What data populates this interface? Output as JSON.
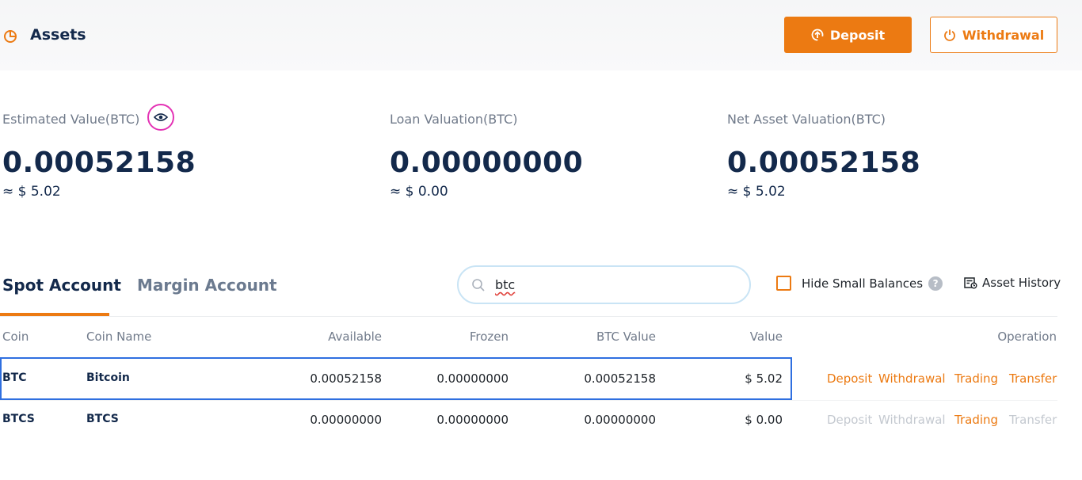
{
  "header": {
    "title": "Assets",
    "deposit_label": "Deposit",
    "withdrawal_label": "Withdrawal"
  },
  "summary": [
    {
      "label": "Estimated Value(BTC)",
      "value": "0.00052158",
      "approx": "≈ $ 5.02"
    },
    {
      "label": "Loan Valuation(BTC)",
      "value": "0.00000000",
      "approx": "≈ $ 0.00"
    },
    {
      "label": "Net Asset Valuation(BTC)",
      "value": "0.00052158",
      "approx": "≈ $ 5.02"
    }
  ],
  "tabs": {
    "spot": "Spot Account",
    "margin": "Margin Account"
  },
  "search": {
    "value": "btc"
  },
  "hide_small_balances": "Hide Small Balances",
  "help_glyph": "?",
  "asset_history": "Asset History",
  "table": {
    "columns": [
      "Coin",
      "Coin Name",
      "Available",
      "Frozen",
      "BTC Value",
      "Value",
      "Operation"
    ],
    "rows": [
      {
        "coin": "BTC",
        "name": "Bitcoin",
        "available": "0.00052158",
        "frozen": "0.00000000",
        "btc_value": "0.00052158",
        "value": "$ 5.02",
        "ops": [
          "Deposit",
          "Withdrawal",
          "Trading",
          "Transfer"
        ]
      },
      {
        "coin": "BTCS",
        "name": "BTCS",
        "available": "0.00000000",
        "frozen": "0.00000000",
        "btc_value": "0.00000000",
        "value": "$ 0.00",
        "ops": [
          "Deposit",
          "Withdrawal",
          "Trading",
          "Transfer"
        ]
      }
    ]
  },
  "colors": {
    "accent": "#ec7a12",
    "title": "#13294b",
    "highlight_border": "#2f6fe0",
    "eye_ring": "#e433b5"
  },
  "icons": {
    "assets": "pie-chart-icon",
    "deposit": "upload-icon",
    "withdrawal": "power-icon",
    "eye": "eye-icon",
    "search": "search-icon",
    "history": "history-icon"
  }
}
